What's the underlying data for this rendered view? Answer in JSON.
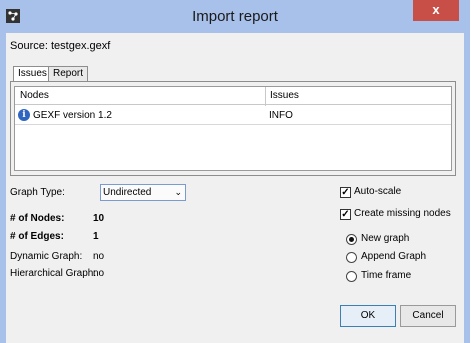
{
  "window": {
    "title": "Import report",
    "close_glyph": "x"
  },
  "source": {
    "label": "Source:",
    "value": "testgex.gexf"
  },
  "tabs": [
    {
      "label": "Issues"
    },
    {
      "label": "Report"
    }
  ],
  "issues_table": {
    "columns": [
      "Nodes",
      "Issues"
    ],
    "rows": [
      {
        "node": "GEXF version 1.2",
        "issue": "INFO",
        "icon": "info-icon"
      }
    ]
  },
  "graph_type": {
    "label": "Graph Type:",
    "value": "Undirected"
  },
  "stats": {
    "nodes": {
      "label": "# of Nodes:",
      "value": "10"
    },
    "edges": {
      "label": "# of Edges:",
      "value": "1"
    },
    "dynamic": {
      "label": "Dynamic Graph:",
      "value": "no"
    },
    "hierarchical": {
      "label": "Hierarchical Graph:",
      "value": "no"
    }
  },
  "options": {
    "auto_scale": {
      "label": "Auto-scale",
      "checked": true
    },
    "create_missing_nodes": {
      "label": "Create missing nodes",
      "checked": true
    }
  },
  "graph_mode": {
    "new_graph": {
      "label": "New graph",
      "selected": true
    },
    "append_graph": {
      "label": "Append Graph",
      "selected": false
    },
    "time_frame": {
      "label": "Time frame",
      "selected": false
    }
  },
  "buttons": {
    "ok": "OK",
    "cancel": "Cancel"
  },
  "colors": {
    "titlebar": "#a7c1ea",
    "close": "#c74f48",
    "info": "#2f64c0"
  }
}
